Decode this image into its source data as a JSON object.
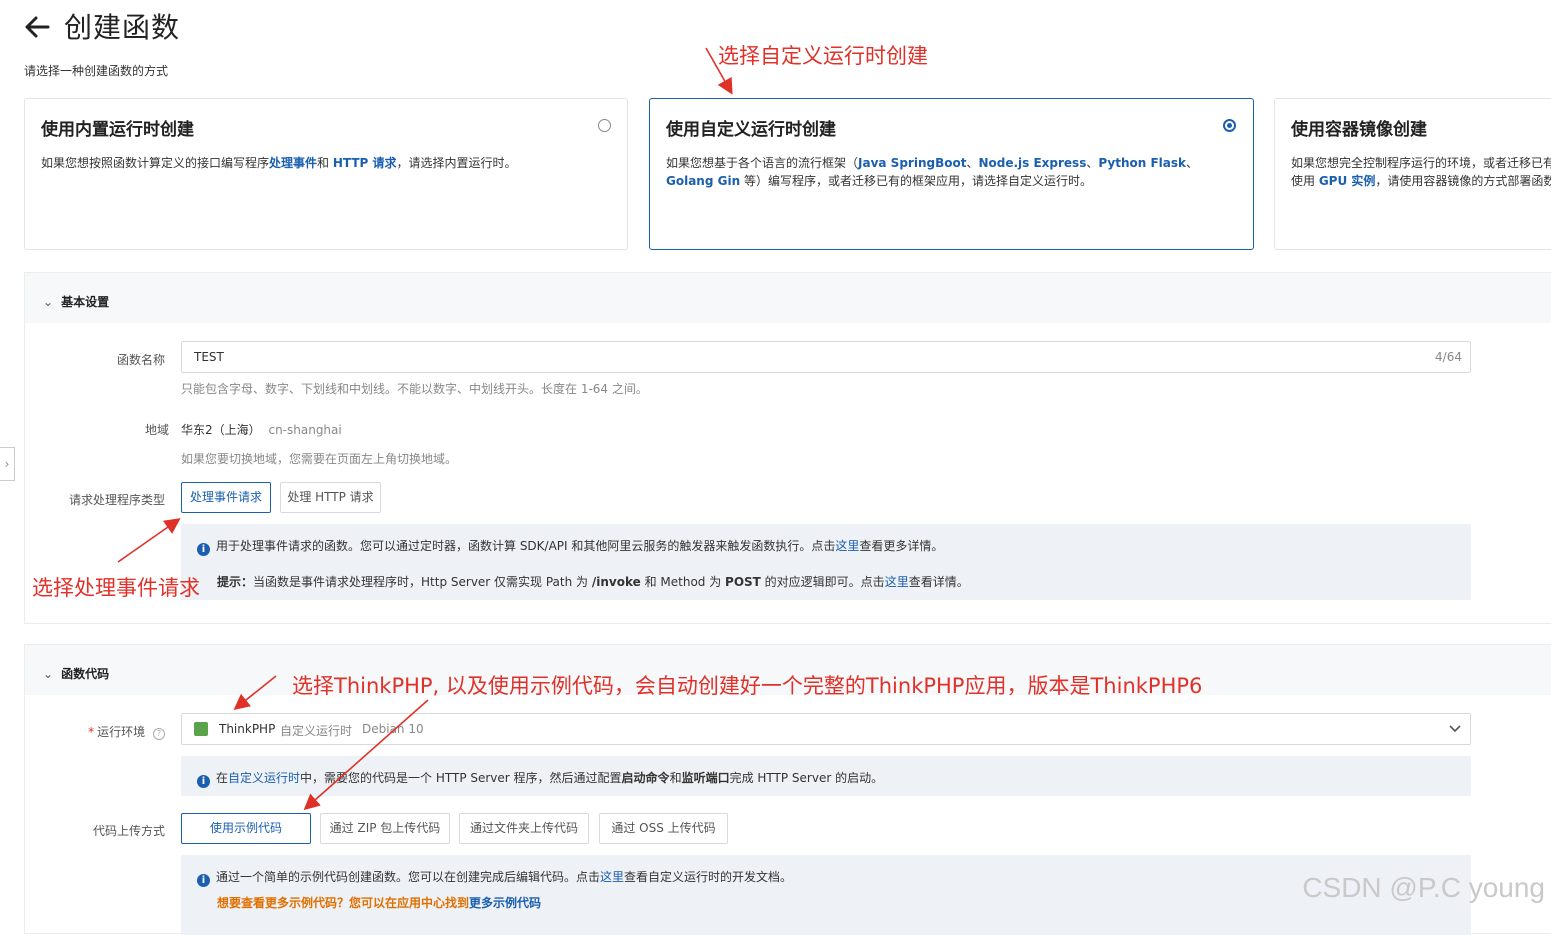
{
  "header": {
    "title": "创建函数",
    "subtitle": "请选择一种创建函数的方式"
  },
  "cards": [
    {
      "title": "使用内置运行时创建",
      "desc_before": "如果您想按照函数计算定义的接口编写程序",
      "link1": "处理事件",
      "desc_mid": "和 ",
      "link2": "HTTP 请求",
      "desc_after": "，请选择内置运行时。",
      "selected": false
    },
    {
      "title": "使用自定义运行时创建",
      "desc_before": "如果您想基于各个语言的流行框架（",
      "frameworks": [
        "Java SpringBoot",
        "Node.js Express",
        "Python Flask",
        "Golang Gin"
      ],
      "desc_after": " 等）编写程序，或者迁移已有的框架应用，请选择自定义运行时。",
      "selected": true
    },
    {
      "title": "使用容器镜像创建",
      "desc_line1": "如果您想完全控制程序运行的环境，或者迁移已有",
      "desc_line2_before": "使用 ",
      "desc_link": "GPU 实例",
      "desc_line2_after": "，请使用容器镜像的方式部署函数",
      "selected": false
    }
  ],
  "basic": {
    "heading": "基本设置",
    "name_label": "函数名称",
    "name_value": "TEST",
    "name_count": "4/64",
    "name_hint": "只能包含字母、数字、下划线和中划线。不能以数字、中划线开头。长度在 1-64 之间。",
    "region_label": "地域",
    "region_value": "华东2（上海）",
    "region_code": "cn-shanghai",
    "region_hint": "如果您要切换地域，您需要在页面左上角切换地域。",
    "handler_label": "请求处理程序类型",
    "handler_options": [
      "处理事件请求",
      "处理 HTTP 请求"
    ],
    "info_line1_before": "用于处理事件请求的函数。您可以通过定时器，函数计算 SDK/API 和其他阿里云服务的触发器来触发函数执行。点击",
    "info_line1_link": "这里",
    "info_line1_after": "查看更多详情。",
    "info_line2_bold": "提示：",
    "info_line2_before": "当函数是事件请求处理程序时，Http Server 仅需实现 Path 为 ",
    "info_line2_path": "/invoke",
    "info_line2_mid": " 和 Method 为 ",
    "info_line2_method": "POST",
    "info_line2_after": " 的对应逻辑即可。点击",
    "info_line2_link": "这里",
    "info_line2_end": "查看详情。"
  },
  "code": {
    "heading": "函数代码",
    "runtime_label": "运行环境",
    "runtime_name": "ThinkPHP",
    "runtime_type": "自定义运行时",
    "runtime_os": "Debian 10",
    "runtime_info_before": "在",
    "runtime_info_link": "自定义运行时",
    "runtime_info_mid": "中，需要您的代码是一个 HTTP Server 程序，然后通过配置",
    "runtime_info_b1": "启动命令",
    "runtime_info_and": "和",
    "runtime_info_b2": "监听端口",
    "runtime_info_after": "完成 HTTP Server 的启动。",
    "upload_label": "代码上传方式",
    "upload_options": [
      "使用示例代码",
      "通过 ZIP 包上传代码",
      "通过文件夹上传代码",
      "通过 OSS 上传代码"
    ],
    "sample_info_before": "通过一个简单的示例代码创建函数。您可以在创建完成后编辑代码。点击",
    "sample_info_link": "这里",
    "sample_info_after": "查看自定义运行时的开发文档。",
    "more_text": "想要查看更多示例代码？您可以在应用中心找到",
    "more_link": "更多示例代码"
  },
  "annotations": {
    "a1": "选择自定义运行时创建",
    "a2": "选择处理事件请求",
    "a3": "选择ThinkPHP, 以及使用示例代码，会自动创建好一个完整的ThinkPHP应用，版本是ThinkPHP6"
  },
  "watermark": "CSDN @P.C young",
  "colors": {
    "accent": "#1b5fb0",
    "annotation": "#e03129",
    "warning": "#e07000"
  }
}
